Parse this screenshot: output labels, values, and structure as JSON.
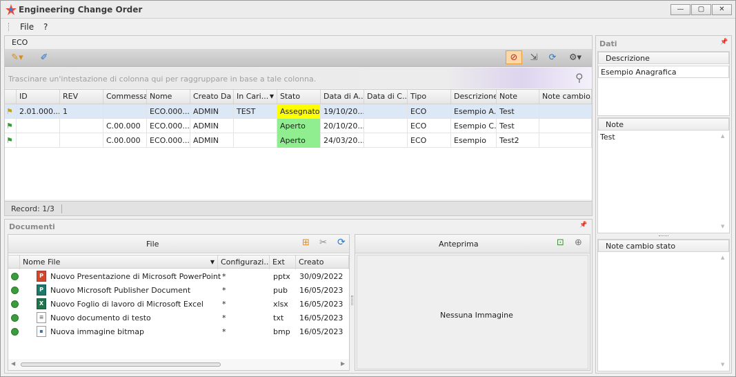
{
  "window": {
    "title": "Engineering Change Order",
    "min": "—",
    "max": "▢",
    "close": "✕"
  },
  "menu": {
    "file": "File",
    "help": "?"
  },
  "eco": {
    "tab_label": "ECO",
    "group_hint": "Trascinare un'intestazione di colonna qui per raggruppare in base a tale colonna.",
    "columns": [
      "ID",
      "REV",
      "Commessa",
      "Nome",
      "Creato Da",
      "In Cari...",
      "Stato",
      "Data di A...",
      "Data di C...",
      "Tipo",
      "Descrizione",
      "Note",
      "Note cambio..."
    ],
    "rows": [
      {
        "id": "2.01.000...",
        "rev": "1",
        "commessa": "",
        "nome": "ECO.000...",
        "creato": "ADMIN",
        "incarico": "TEST",
        "stato": "Assegnato",
        "data_a": "19/10/20...",
        "data_c": "",
        "tipo": "ECO",
        "descrizione": "Esempio A...",
        "note": "Test",
        "note_cambio": ""
      },
      {
        "id": "",
        "rev": "",
        "commessa": "C.00.000",
        "nome": "ECO.000...",
        "creato": "ADMIN",
        "incarico": "",
        "stato": "Aperto",
        "data_a": "20/10/20...",
        "data_c": "",
        "tipo": "ECO",
        "descrizione": "Esempio C...",
        "note": "Test",
        "note_cambio": ""
      },
      {
        "id": "",
        "rev": "",
        "commessa": "C.00.000",
        "nome": "ECO.000...",
        "creato": "ADMIN",
        "incarico": "",
        "stato": "Aperto",
        "data_a": "24/03/20...",
        "data_c": "",
        "tipo": "ECO",
        "descrizione": "Esempio",
        "note": "Test2",
        "note_cambio": ""
      }
    ],
    "record": "Record: 1/3",
    "status_colors": {
      "Assegnato": "#ffff00",
      "Aperto": "#90ee90"
    }
  },
  "documents": {
    "title": "Documenti",
    "file_title": "File",
    "preview_title": "Anteprima",
    "no_image": "Nessuna Immagine",
    "columns": [
      "Nome File",
      "Configurazi...",
      "Ext",
      "Creato"
    ],
    "files": [
      {
        "name": "Nuovo Presentazione di Microsoft PowerPoint",
        "config": "*",
        "ext": "pptx",
        "created": "30/09/2022",
        "icon": "powerpoint-icon"
      },
      {
        "name": "Nuovo Microsoft Publisher Document",
        "config": "*",
        "ext": "pub",
        "created": "16/05/2023",
        "icon": "publisher-icon"
      },
      {
        "name": "Nuovo Foglio di lavoro di Microsoft Excel",
        "config": "*",
        "ext": "xlsx",
        "created": "16/05/2023",
        "icon": "excel-icon"
      },
      {
        "name": "Nuovo documento di testo",
        "config": "*",
        "ext": "txt",
        "created": "16/05/2023",
        "icon": "text-file-icon"
      },
      {
        "name": "Nuova immagine bitmap",
        "config": "*",
        "ext": "bmp",
        "created": "16/05/2023",
        "icon": "bitmap-icon"
      }
    ]
  },
  "side": {
    "title": "Dati",
    "descrizione_label": "Descrizione",
    "descrizione_value": "Esempio Anagrafica",
    "note_label": "Note",
    "note_value": "Test",
    "note_cambio_label": "Note cambio stato",
    "note_cambio_value": ""
  }
}
